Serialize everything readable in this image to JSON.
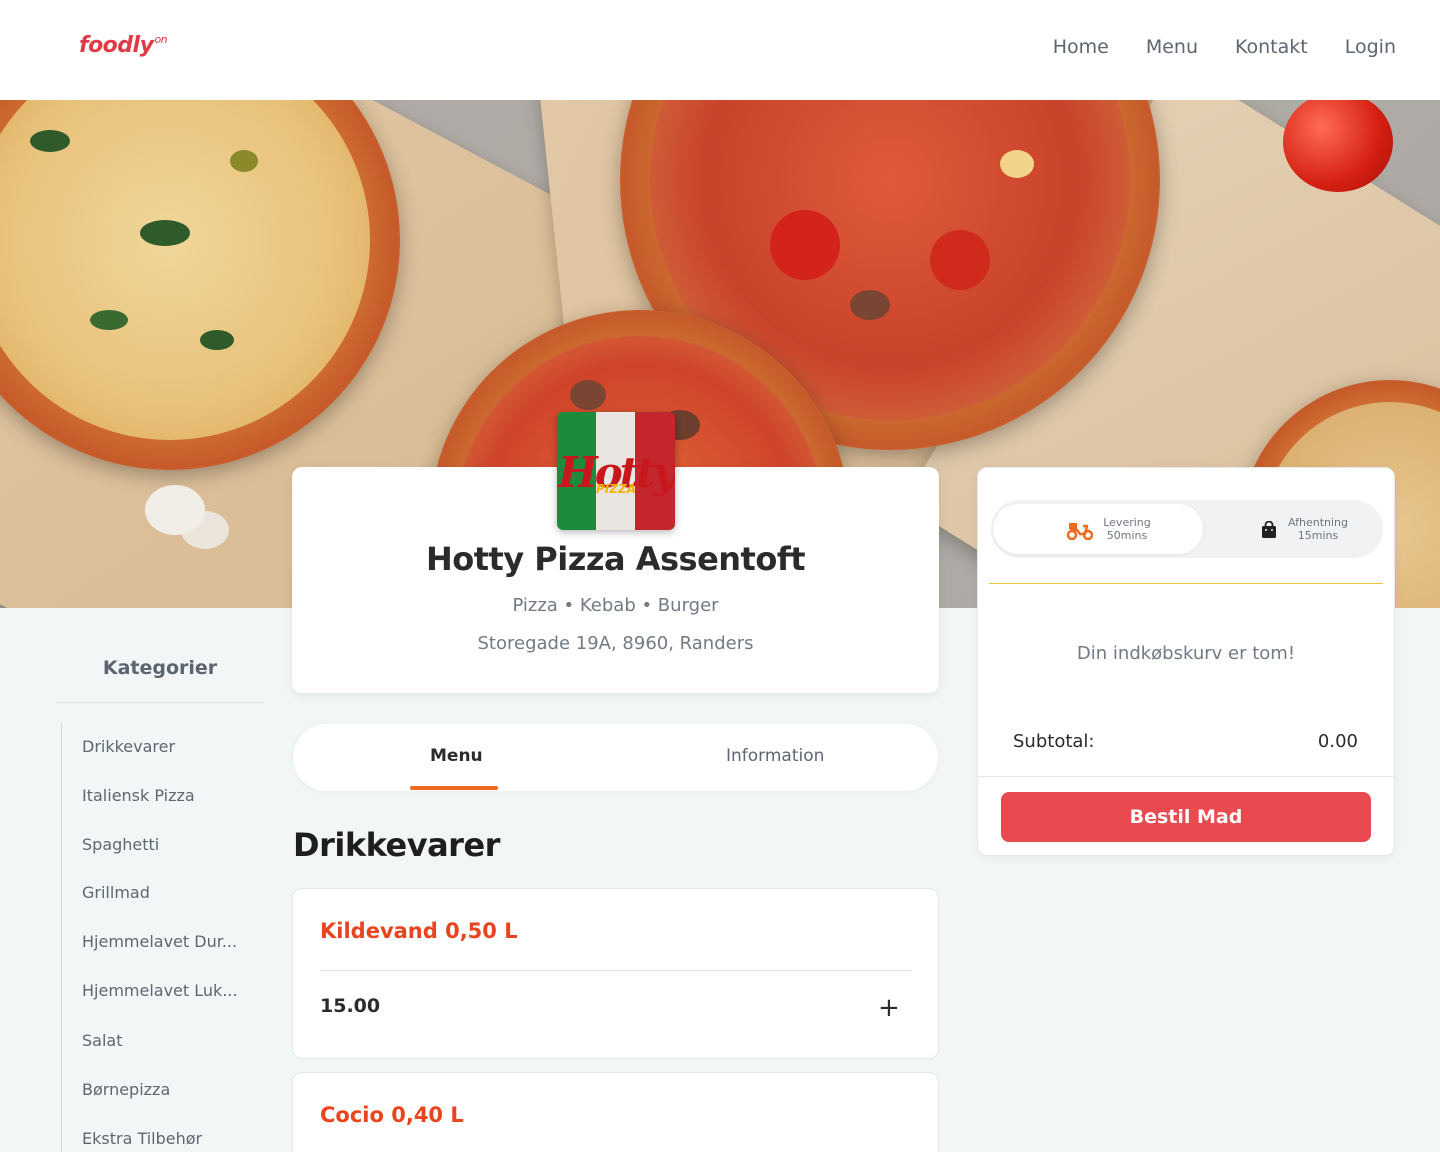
{
  "header": {
    "logo_text": "foodly",
    "logo_sup": "on",
    "nav": [
      "Home",
      "Menu",
      "Kontakt",
      "Login"
    ]
  },
  "restaurant": {
    "logo_text": "Hotty",
    "logo_sub": "PIZZA",
    "name": "Hotty Pizza Assentoft",
    "cuisine": "Pizza • Kebab • Burger",
    "address": "Storegade 19A, 8960, Randers"
  },
  "sidebar": {
    "title": "Kategorier",
    "items": [
      "Drikkevarer",
      "Italiensk Pizza",
      "Spaghetti",
      "Grillmad",
      "Hjemmelavet Dur...",
      "Hjemmelavet Luk...",
      "Salat",
      "Børnepizza",
      "Ekstra Tilbehør"
    ]
  },
  "tabs": [
    {
      "label": "Menu",
      "active": true
    },
    {
      "label": "Information",
      "active": false
    }
  ],
  "menu": {
    "section_title": "Drikkevarer",
    "items": [
      {
        "name": "Kildevand 0,50 L",
        "price": "15.00",
        "add": "+"
      },
      {
        "name": "Cocio 0,40 L",
        "price": "",
        "add": ""
      }
    ]
  },
  "cart": {
    "delivery": {
      "label": "Levering",
      "time": "50mins",
      "icon": "scooter-icon",
      "active": true
    },
    "pickup": {
      "label": "Afhentning",
      "time": "15mins",
      "icon": "shopping-bag-icon",
      "active": false
    },
    "empty_message": "Din indkøbskurv er tom!",
    "subtotal_label": "Subtotal:",
    "subtotal_value": "0.00",
    "order_button": "Bestil Mad"
  },
  "colors": {
    "brand": "#e23a44",
    "accent_orange": "#ee6a1e",
    "item_name": "#e8441e",
    "order_button": "#e84a4f",
    "divider_yellow": "#f2c240"
  }
}
